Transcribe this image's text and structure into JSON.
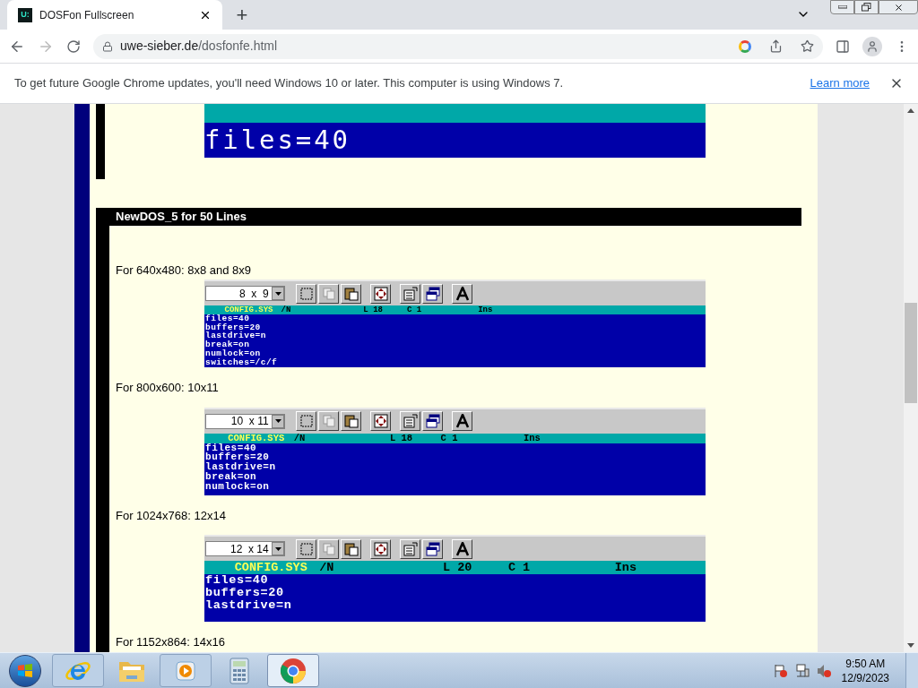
{
  "browser": {
    "tab": {
      "title": "DOSFon Fullscreen",
      "favicon": "U:",
      "selected": true
    },
    "new_tab": "+",
    "address": {
      "host": "uwe-sieber.de",
      "path": "/dosfonfe.html"
    }
  },
  "infobar": {
    "message": "To get future Google Chrome updates, you'll need Windows 10 or later. This computer is using Windows 7.",
    "link": "Learn more"
  },
  "page": {
    "top_fragment": {
      "lines": [
        "files=40"
      ]
    },
    "section": {
      "title": "NewDOS_5 for 50 Lines",
      "items": [
        {
          "caption": "For 640x480: 8x8 and 8x9",
          "editor": {
            "kind": "small",
            "size": "8  x  9",
            "file": "CONFIG.SYS",
            "switch": "/N",
            "line": "L 18",
            "col": "C 1",
            "mode": "Ins",
            "lines": [
              "files=40",
              "buffers=20",
              "lastdrive=n",
              "break=on",
              "numlock=on",
              "switches=/c/f"
            ]
          }
        },
        {
          "caption": "For 800x600: 10x11",
          "editor": {
            "kind": "medium",
            "size": "10  x 11",
            "file": "CONFIG.SYS",
            "switch": "/N",
            "line": "L 18",
            "col": "C 1",
            "mode": "Ins",
            "lines": [
              "files=40",
              "buffers=20",
              "lastdrive=n",
              "break=on",
              "numlock=on"
            ]
          }
        },
        {
          "caption": "For 1024x768: 12x14",
          "editor": {
            "kind": "large",
            "size": "12  x 14",
            "file": "CONFIG.SYS",
            "switch": "/N",
            "line": "L 20",
            "col": "C 1",
            "mode": "Ins",
            "lines": [
              "files=40",
              "buffers=20",
              "lastdrive=n"
            ]
          }
        },
        {
          "caption": "For 1152x864: 14x16"
        }
      ]
    }
  },
  "taskbar": {
    "apps": [
      {
        "kind": "ie",
        "selected": false
      },
      {
        "kind": "folder",
        "selected": false
      },
      {
        "kind": "media",
        "selected": false
      },
      {
        "kind": "calculator",
        "selected": false
      },
      {
        "kind": "chrome",
        "selected": true
      }
    ],
    "time": "9:50 AM",
    "date": "12/9/2023"
  }
}
